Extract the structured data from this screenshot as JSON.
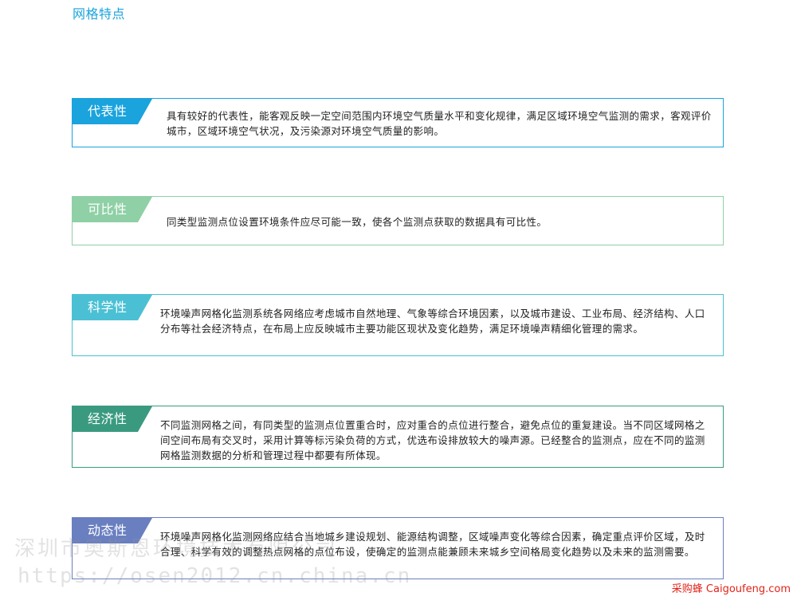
{
  "page": {
    "title": "网格特点"
  },
  "cards": [
    {
      "tag": "代表性",
      "color": "#1aa3dc",
      "text": "具有较好的代表性，能客观反映一定空间范围内环境空气质量水平和变化规律，满足区域环境空气监测的需求，客观评价城市，区域环境空气状况，及污染源对环境空气质量的影响。"
    },
    {
      "tag": "可比性",
      "color": "#8fd0a6",
      "text": "同类型监测点位设置环境条件应尽可能一致，使各个监测点获取的数据具有可比性。"
    },
    {
      "tag": "科学性",
      "color": "#4bc0d4",
      "text": "环境噪声网格化监测系统各网络应考虑城市自然地理、气象等综合环境因素，以及城市建设、工业布局、经济结构、人口分布等社会经济特点，在布局上应反映城市主要功能区现状及变化趋势，满足环境噪声精细化管理的需求。"
    },
    {
      "tag": "经济性",
      "color": "#3a9a80",
      "text": "不同监测网格之间，有同类型的监测点位置重合时，应对重合的点位进行整合，避免点位的重复建设。当不同区域网格之间空间布局有交叉时，采用计算等标污染负荷的方式，优选布设排放较大的噪声源。已经整合的监测点，应在不同的监测网格监测数据的分析和管理过程中都要有所体现。"
    },
    {
      "tag": "动态性",
      "color": "#6a7fc0",
      "text": "环境噪声网格化监测网络应结合当地城乡建设规划、能源结构调整，区域噪声变化等综合因素，确定重点评价区域，及时合理、科学有效的调整热点网格的点位布设，使确定的监测点能兼顾未来城乡空间格局变化趋势以及未来的监测需要。"
    }
  ],
  "watermark": {
    "line1": "深圳市奥斯恩环境技术有限公司",
    "line2": "https://osen2012.cn.china.cn"
  },
  "footer": {
    "text": "采购蜂 Caigoufeng.com"
  }
}
